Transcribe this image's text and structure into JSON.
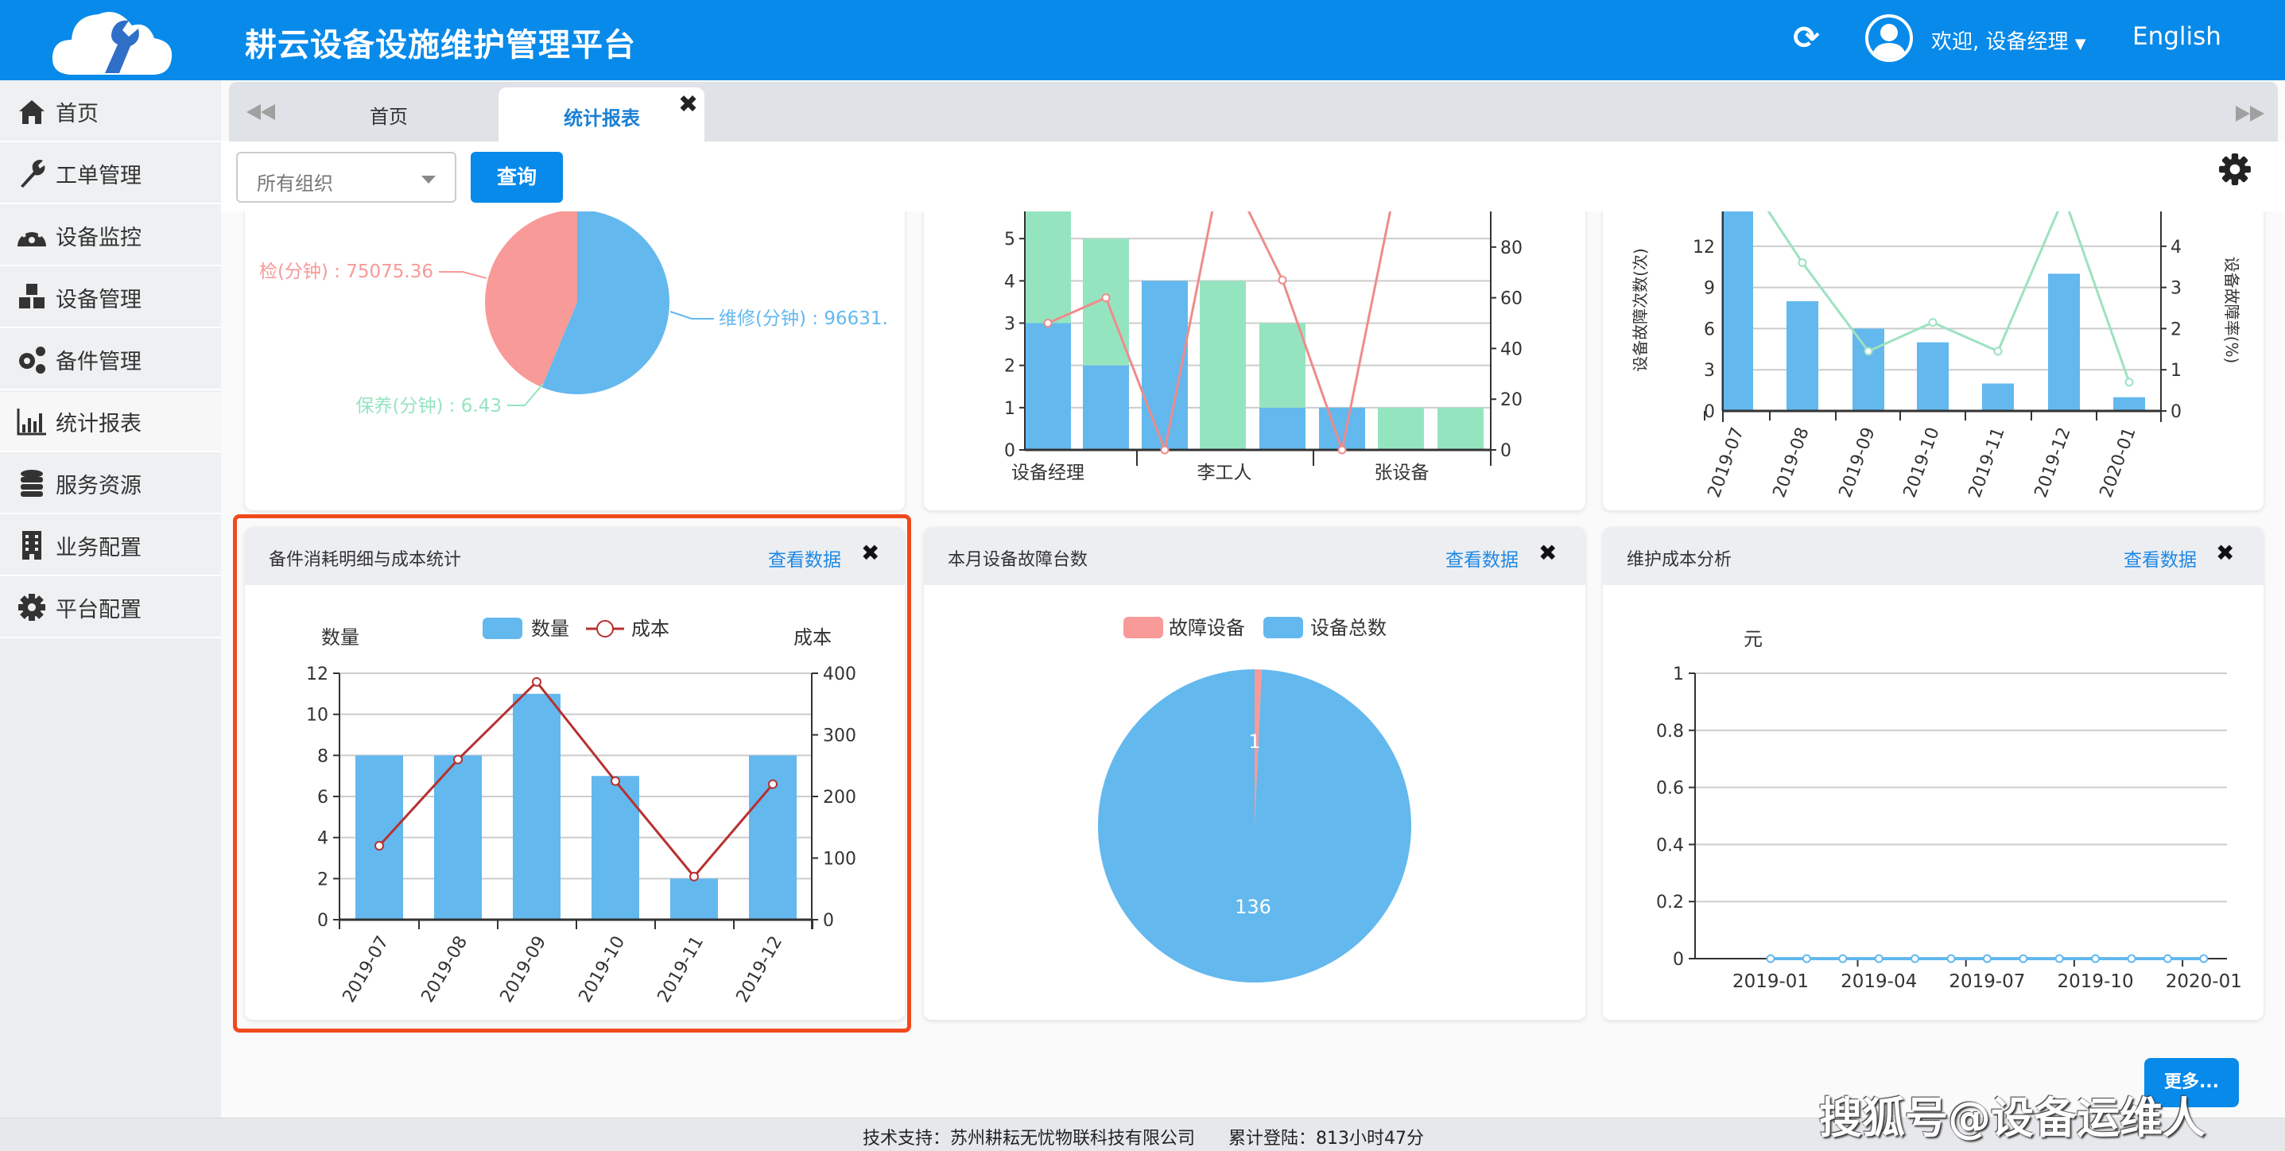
{
  "header": {
    "title": "耕云设备设施维护管理平台",
    "welcome": "欢迎, 设备经理",
    "language": "English"
  },
  "sidebar": {
    "items": [
      {
        "label": "首页",
        "icon": "home-icon"
      },
      {
        "label": "工单管理",
        "icon": "wrench-icon"
      },
      {
        "label": "设备监控",
        "icon": "dashboard-icon"
      },
      {
        "label": "设备管理",
        "icon": "cubes-icon"
      },
      {
        "label": "备件管理",
        "icon": "gears-icon"
      },
      {
        "label": "统计报表",
        "icon": "bar-chart-icon",
        "active": true
      },
      {
        "label": "服务资源",
        "icon": "database-icon"
      },
      {
        "label": "业务配置",
        "icon": "building-icon"
      },
      {
        "label": "平台配置",
        "icon": "gear-icon"
      }
    ]
  },
  "tabs": [
    {
      "label": "首页"
    },
    {
      "label": "统计报表",
      "active": true
    }
  ],
  "toolbar": {
    "org_select": "所有组织",
    "query": "查询"
  },
  "cards": {
    "view_data": "查看数据",
    "bottom": [
      {
        "title": "备件消耗明细与成本统计"
      },
      {
        "title": "本月设备故障台数"
      },
      {
        "title": "维护成本分析"
      }
    ]
  },
  "more_button": "更多...",
  "watermark": "搜狐号@设备运维人",
  "footer": {
    "support": "技术支持：苏州耕耘无忧物联科技有限公司",
    "login": "累计登陆：813小时47分"
  },
  "colors": {
    "brand": "#078aea",
    "bar_blue": "#63b8ee",
    "bar_green": "#95e4c0",
    "pink": "#f79a98",
    "cost_line": "#b73030",
    "highlight": "#f04a1c",
    "link": "#1e88e5"
  },
  "chart_data": [
    {
      "type": "pie",
      "slices": [
        {
          "label": "维修(分钟) : 96631.",
          "value": 96631,
          "color": "#63b8ee"
        },
        {
          "label": "保养(分钟) : 6.43",
          "value": 6.43,
          "color": "#95e4c0"
        },
        {
          "label": "检(分钟) : 75075.36",
          "value": 75075.36,
          "color": "#f79a98"
        }
      ]
    },
    {
      "type": "bar",
      "stacked": true,
      "categories": [
        "设备经理",
        "李工人",
        "张设备"
      ],
      "ylim": [
        0,
        6
      ],
      "yticks": [
        "0",
        "1",
        "2",
        "3",
        "4",
        "5"
      ],
      "y2lim": [
        0,
        100
      ],
      "y2ticks": [
        "0",
        "20",
        "40",
        "60",
        "80"
      ],
      "series": [
        {
          "color": "#63b8ee",
          "values": [
            3,
            2,
            4,
            0,
            1,
            1,
            0,
            0
          ]
        },
        {
          "color": "#95e4c0",
          "values": [
            3,
            3,
            0,
            4,
            2,
            0,
            1,
            1
          ]
        }
      ],
      "line": {
        "color": "#ee8c8c",
        "values": [
          50,
          60,
          0,
          115,
          67,
          0,
          115
        ]
      }
    },
    {
      "type": "bar",
      "categories": [
        "2019-07",
        "2019-08",
        "2019-09",
        "2019-10",
        "2019-11",
        "2019-12",
        "2020-01"
      ],
      "ylabel": "设备故障次数(次)",
      "y2label": "设备故障率(%)",
      "ylim": [
        0,
        15
      ],
      "yticks": [
        "0",
        "3",
        "6",
        "9",
        "12"
      ],
      "y2lim": [
        0,
        5
      ],
      "y2ticks": [
        "0",
        "1",
        "2",
        "3",
        "4"
      ],
      "bars": {
        "color": "#63b8ee",
        "values": [
          15,
          8,
          6,
          5,
          2,
          10,
          1
        ]
      },
      "line": {
        "color": "#9de2c0",
        "values": [
          6,
          3.6,
          1.45,
          2.15,
          1.45,
          5.2,
          0.7
        ]
      }
    },
    {
      "type": "bar",
      "categories": [
        "2019-07",
        "2019-08",
        "2019-09",
        "2019-10",
        "2019-11",
        "2019-12"
      ],
      "ylabel": "数量",
      "y2label": "成本",
      "legend": [
        "数量",
        "成本"
      ],
      "ylim": [
        0,
        12
      ],
      "yticks": [
        "0",
        "2",
        "4",
        "6",
        "8",
        "10",
        "12"
      ],
      "y2lim": [
        0,
        400
      ],
      "y2ticks": [
        "0",
        "100",
        "200",
        "300",
        "400"
      ],
      "series": [
        {
          "name": "数量",
          "color": "#63b8ee",
          "values": [
            8,
            8,
            11,
            7,
            2,
            8
          ]
        },
        {
          "name": "成本",
          "color": "#b73030",
          "values": [
            120,
            260,
            386,
            225,
            70,
            220
          ]
        }
      ]
    },
    {
      "type": "pie",
      "legend": [
        "故障设备",
        "设备总数"
      ],
      "slices": [
        {
          "label": "故障设备",
          "value": 1,
          "text": "1",
          "color": "#f79a98"
        },
        {
          "label": "设备总数",
          "value": 136,
          "text": "136",
          "color": "#63b8ee"
        }
      ]
    },
    {
      "type": "line",
      "ylabel": "元",
      "ylim": [
        0,
        1
      ],
      "yticks": [
        "0",
        "0.2",
        "0.4",
        "0.6",
        "0.8",
        "1"
      ],
      "x": [
        "2019-01",
        "2019-02",
        "2019-03",
        "2019-04",
        "2019-05",
        "2019-06",
        "2019-07",
        "2019-08",
        "2019-09",
        "2019-10",
        "2019-11",
        "2019-12",
        "2020-01"
      ],
      "xticks": [
        "2019-01",
        "2019-04",
        "2019-07",
        "2019-10",
        "2020-01"
      ],
      "values": [
        0,
        0,
        0,
        0,
        0,
        0,
        0,
        0,
        0,
        0,
        0,
        0,
        0
      ],
      "color": "#63b8ee"
    }
  ]
}
